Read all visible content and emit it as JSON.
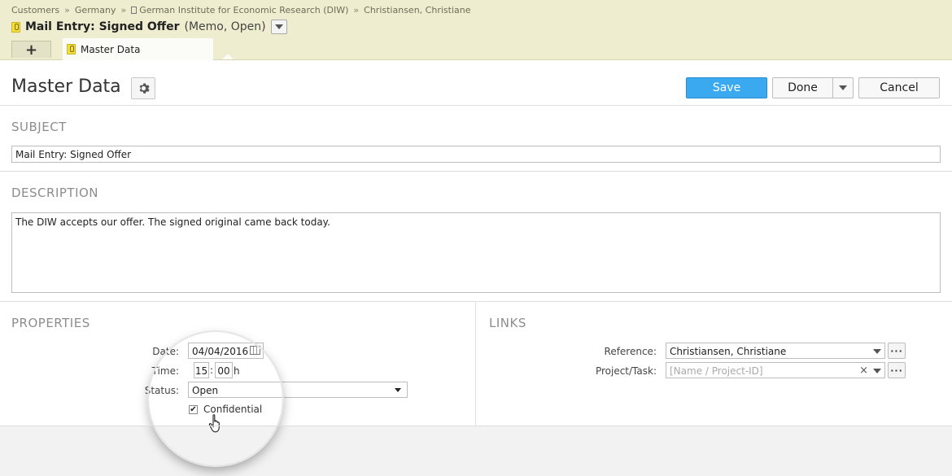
{
  "breadcrumbs": [
    "Customers",
    "Germany",
    "German Institute for Economic Research (DIW)",
    "Christiansen, Christiane"
  ],
  "breadcrumb_sep": "»",
  "title": {
    "main": "Mail Entry: Signed Offer",
    "meta": "(Memo, Open)"
  },
  "tabs": {
    "add": "+",
    "active": "Master Data"
  },
  "page": {
    "heading": "Master Data"
  },
  "actions": {
    "save": "Save",
    "done": "Done",
    "cancel": "Cancel"
  },
  "subject": {
    "heading": "SUBJECT",
    "value": "Mail Entry: Signed Offer"
  },
  "description": {
    "heading": "DESCRIPTION",
    "value": "The DIW accepts our offer. The signed original came back today."
  },
  "properties": {
    "heading": "PROPERTIES",
    "date_label": "Date:",
    "date_value": "04/04/2016",
    "time_label": "Time:",
    "time_hour": "15",
    "time_sep": ":",
    "time_min": "00",
    "time_unit": "h",
    "status_label": "Status:",
    "status_value": "Open",
    "confidential_label": "Confidential",
    "confidential_checked": true
  },
  "links": {
    "heading": "LINKS",
    "reference_label": "Reference:",
    "reference_value": "Christiansen, Christiane",
    "project_label": "Project/Task:",
    "project_placeholder": "[Name / Project-ID]",
    "ellipsis": "···"
  },
  "colors": {
    "accent": "#3aa9f0",
    "header_bg": "#efedcf",
    "memo_icon": "#f5df3a"
  }
}
